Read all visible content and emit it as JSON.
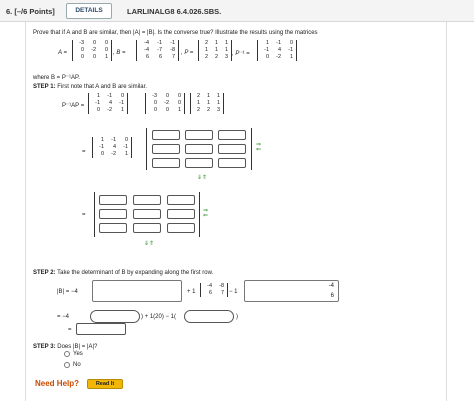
{
  "header": {
    "qnum": "6.",
    "points": "[–/6 Points]",
    "details": "DETAILS",
    "code": "LARLINALG8 6.4.026.SBS."
  },
  "prompt": "Prove that if A and B are similar, then |A| = |B|. Is the converse true? Illustrate the results using the matrices",
  "A": [
    "-3",
    "0",
    "0",
    "0",
    "-2",
    "0",
    "0",
    "0",
    "1"
  ],
  "B": [
    "-4",
    "-1",
    "-1",
    "-4",
    "-7",
    "-8",
    "6",
    "6",
    "7"
  ],
  "P": [
    "2",
    "1",
    "1",
    "1",
    "1",
    "1",
    "2",
    "2",
    "3"
  ],
  "Pinv": [
    "1",
    "-1",
    "0",
    "-1",
    "4",
    "-1",
    "0",
    "-2",
    "1"
  ],
  "labels": {
    "A": "A =",
    "B": ", B =",
    "P": ", P =",
    "Pinv": ", P⁻¹ ="
  },
  "where": "where B = P⁻¹AP.",
  "step1": {
    "label": "STEP 1:",
    "text": "First note that A and B are similar.",
    "lhs": "P⁻¹AP =",
    "eq": "="
  },
  "arrows": {
    "right": "⇒",
    "left": "⇐",
    "down": "⇓⇑"
  },
  "step2": {
    "label": "STEP 2:",
    "text": "Take the determinant of B by expanding along the first row.",
    "lhs": "|B| = −4",
    "plus1": "+ 1",
    "minor": [
      "-4",
      "-8",
      "6",
      "7"
    ],
    "minus1": "− 1",
    "box_a": "-4",
    "box_b": "6",
    "row2_pre": "= −4",
    "row2_mid": ") + 1(20) − 1(",
    "row2_end": ")",
    "row3": "="
  },
  "step3": {
    "label": "STEP 3:",
    "text": "Does |B| = |A|?",
    "opt_yes": "Yes",
    "opt_no": "No"
  },
  "help": {
    "label": "Need Help?",
    "read": "Read It"
  }
}
